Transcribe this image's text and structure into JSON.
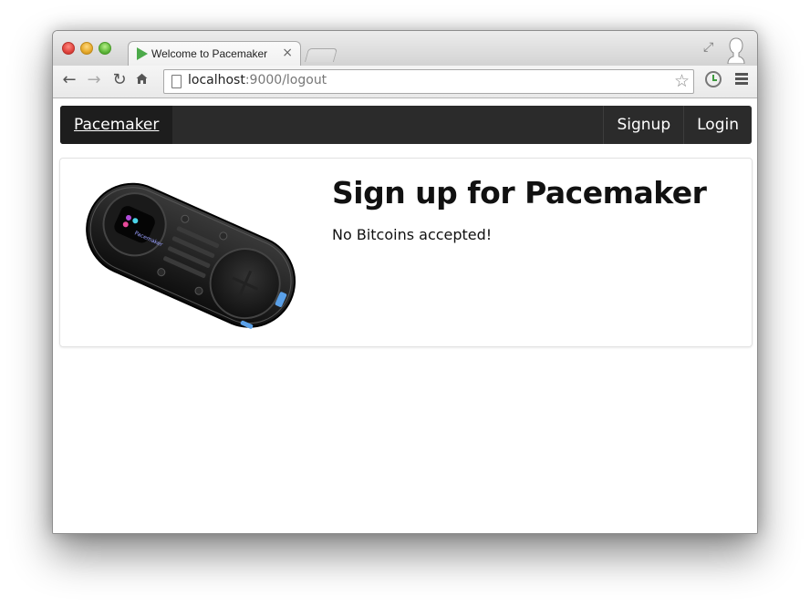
{
  "browser": {
    "tab_title": "Welcome to Pacemaker",
    "tab_close": "×",
    "url_host": "localhost",
    "url_path": ":9000/logout"
  },
  "navbar": {
    "brand": "Pacemaker",
    "items": [
      {
        "label": "Signup"
      },
      {
        "label": "Login"
      }
    ]
  },
  "jumbotron": {
    "heading": "Sign up for Pacemaker",
    "subtext": "No Bitcoins accepted!",
    "device_label": "Pacemaker"
  },
  "icons": {
    "back": "back-arrow-icon",
    "forward": "forward-arrow-icon",
    "reload": "reload-icon",
    "home": "home-icon",
    "star": "star-icon",
    "history": "clock-icon",
    "menu": "menu-icon",
    "fullscreen": "fullscreen-icon",
    "profile": "profile-icon"
  },
  "colors": {
    "navbar_bg": "#2b2b2b",
    "favicon": "#4caa4a"
  }
}
